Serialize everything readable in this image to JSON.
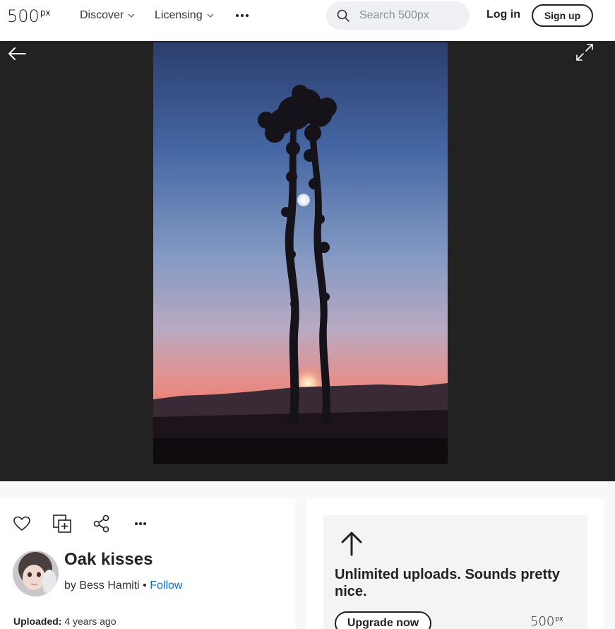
{
  "header": {
    "logo_main": "500",
    "logo_sup": "px",
    "nav": [
      {
        "label": "Discover",
        "icon": "chevron-down-icon"
      },
      {
        "label": "Licensing",
        "icon": "chevron-down-icon"
      }
    ],
    "more_icon": "more-dots-icon",
    "search": {
      "placeholder": "Search 500px",
      "value": "",
      "icon": "search-icon"
    },
    "login_label": "Log in",
    "signup_label": "Sign up"
  },
  "stage": {
    "background": "#222222",
    "back_icon": "arrow-left-icon",
    "expand_icon": "expand-icon"
  },
  "photo": {
    "description_icon": "photo"
  },
  "actions": [
    {
      "name": "like",
      "icon": "heart-icon"
    },
    {
      "name": "add-to-gallery",
      "icon": "add-gallery-icon"
    },
    {
      "name": "share",
      "icon": "share-icon"
    },
    {
      "name": "more",
      "icon": "more-dots-icon"
    }
  ],
  "info": {
    "title": "Oak kisses",
    "by_prefix": "by",
    "author": "Bess Hamiti",
    "separator": "•",
    "follow_label": "Follow",
    "uploaded_label": "Uploaded:",
    "uploaded_value": "4 years ago"
  },
  "promo": {
    "icon": "arrow-up-icon",
    "headline": "Unlimited uploads. Sounds pretty nice.",
    "button_label": "Upgrade now",
    "logo_main": "500",
    "logo_sup": "px"
  },
  "colors": {
    "link": "#0870d1",
    "dark": "#222222"
  }
}
